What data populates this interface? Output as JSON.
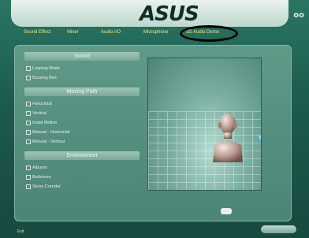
{
  "header": {
    "logo_text": "ASUS",
    "window_controls": "oo"
  },
  "tabs": [
    {
      "label": "Sound Effect"
    },
    {
      "label": "Mixer"
    },
    {
      "label": "Audio I/O"
    },
    {
      "label": "Microphone"
    },
    {
      "label": "3D Audio Demo",
      "active": true
    }
  ],
  "sections": {
    "sound": {
      "title": "Sound",
      "options": [
        "Looping Mode",
        "Buzzing Bee"
      ]
    },
    "moving_path": {
      "title": "Moving Path",
      "options": [
        "Horizontal",
        "Vertical",
        "Iostat Motion",
        "Manual - Horizontal",
        "Manual - Vertical"
      ]
    },
    "environment": {
      "title": "Environment",
      "options": [
        "Alburen",
        "Bathroom",
        "Stone Corridor"
      ]
    }
  },
  "footer": {
    "left_text": "Exit"
  },
  "colors": {
    "tab_text": "#f4e57a",
    "accent_ball": "#2ec6ee"
  }
}
